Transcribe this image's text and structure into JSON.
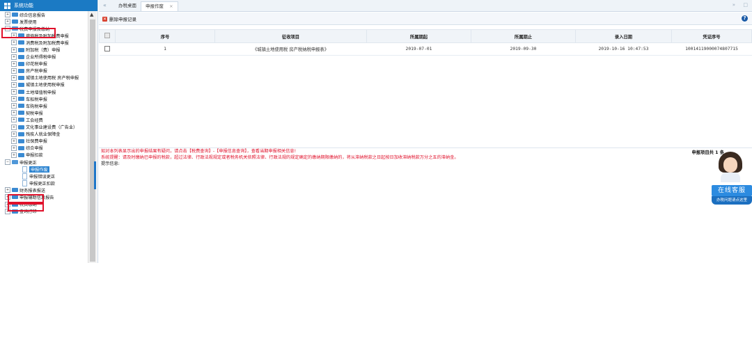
{
  "sidebar": {
    "title": "系统功能",
    "items": [
      {
        "label": "综合信息报告",
        "toggle": "+",
        "type": "folder"
      },
      {
        "label": "发票使用",
        "toggle": "+",
        "type": "folder"
      },
      {
        "label": "税费申报及缴纳",
        "toggle": "−",
        "type": "folder-open"
      },
      {
        "label": "增值税及附加税费申报",
        "toggle": "+",
        "type": "folder"
      },
      {
        "label": "消费税及附加税费申报",
        "toggle": "+",
        "type": "folder"
      },
      {
        "label": "附加税（费）申报",
        "toggle": "+",
        "type": "folder"
      },
      {
        "label": "企业所得税申报",
        "toggle": "+",
        "type": "folder"
      },
      {
        "label": "印花税申报",
        "toggle": "+",
        "type": "folder"
      },
      {
        "label": "房产税申报",
        "toggle": "+",
        "type": "folder"
      },
      {
        "label": "城镇土地使用税 房产税申报",
        "toggle": "+",
        "type": "folder"
      },
      {
        "label": "城镇土地使用税申报",
        "toggle": "+",
        "type": "folder"
      },
      {
        "label": "土地增值税申报",
        "toggle": "+",
        "type": "folder"
      },
      {
        "label": "车船税申报",
        "toggle": "+",
        "type": "folder"
      },
      {
        "label": "车购税申报",
        "toggle": "+",
        "type": "folder"
      },
      {
        "label": "契税申报",
        "toggle": "+",
        "type": "folder"
      },
      {
        "label": "工会经费",
        "toggle": "+",
        "type": "folder"
      },
      {
        "label": "文化事业建设费（广告业）",
        "toggle": "+",
        "type": "folder"
      },
      {
        "label": "残疾人就业保障金",
        "toggle": "+",
        "type": "folder"
      },
      {
        "label": "社保费申报",
        "toggle": "+",
        "type": "folder"
      },
      {
        "label": "综合申报",
        "toggle": "+",
        "type": "folder"
      },
      {
        "label": "申报扣款",
        "toggle": "+",
        "type": "folder"
      },
      {
        "label": "申报更正",
        "toggle": "−",
        "type": "folder-open"
      },
      {
        "label": "申报作废",
        "type": "doc",
        "selected": true
      },
      {
        "label": "申报错误更正",
        "type": "doc"
      },
      {
        "label": "申报更正扣款",
        "type": "doc"
      },
      {
        "label": "财务报表报送",
        "toggle": "+",
        "type": "folder"
      },
      {
        "label": "申报辅助信息报告",
        "toggle": "+",
        "type": "folder"
      },
      {
        "label": "税费缴纳",
        "toggle": "+",
        "type": "folder"
      },
      {
        "label": "查询打印",
        "toggle": "+",
        "type": "folder"
      }
    ]
  },
  "tabs": {
    "nav_left": "«",
    "nav_right": "»",
    "items": [
      {
        "label": "办税桌面"
      },
      {
        "label": "申报作废",
        "close": "×"
      }
    ]
  },
  "toolbar": {
    "delete_label": "删除申报记录",
    "help": "?"
  },
  "table": {
    "columns": [
      "序号",
      "征收项目",
      "所属期起",
      "所属期止",
      "录入日期",
      "凭证序号"
    ],
    "rows": [
      [
        "1",
        "《城镇土地使用税 房产税纳税申报表》",
        "2019-07-01",
        "2019-09-30",
        "2019-10-16 10:47:53",
        "10014119000074807715"
      ]
    ]
  },
  "notes": {
    "line1": "如对本列表显示出的申报结果有疑问，请点击【税费查询】-【申报信息查询】，查看当期申报相关信息!",
    "line2": "系统提醒：请及时缴纳已申报的税款，超过法律、行政法规规定或者税务机关依照法律、行政法规的规定确定的缴纳期限缴纳的，将从滞纳税款之日起按日加收滞纳税款万分之五的滞纳金。",
    "line3": "提示信息:",
    "count": "申报项目共 1 条"
  },
  "service": {
    "title": "在线客服",
    "subtitle": "办税问题请点这里"
  },
  "colors": {
    "header_blue": "#1b7ac4",
    "highlight_red": "#e0102a",
    "selected_blue": "#2b83d0"
  }
}
